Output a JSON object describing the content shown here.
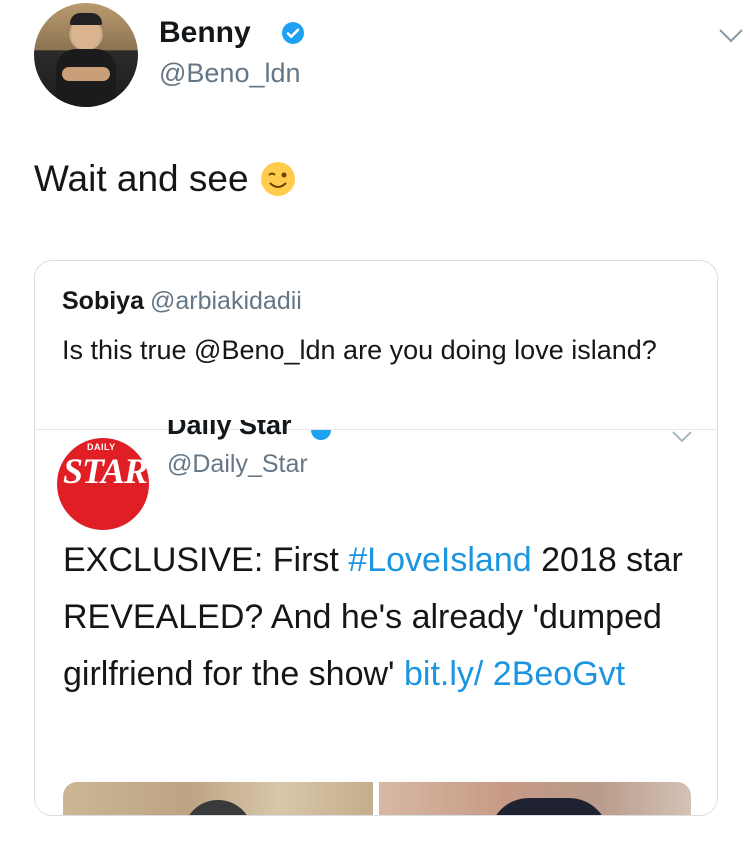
{
  "tweet": {
    "author_name": "Benny",
    "author_handle": "@Beno_ldn",
    "text": "Wait and see",
    "emoji": "winking-face",
    "verified": true
  },
  "quote": {
    "author_name": "Sobiya",
    "author_handle": "@arbiakidadii",
    "text": "Is this true @Beno_ldn are you doing love island?"
  },
  "embedded": {
    "logo_small_text": "DAILY",
    "logo_text": "STAR",
    "author_name": "Daily Star",
    "author_handle": "@Daily_Star",
    "text_part1": "EXCLUSIVE: First ",
    "hashtag": "#LoveIsland",
    "text_part2": " 2018 star REVEALED? And he's already 'dumped girlfriend for the show' ",
    "link": "bit.ly/ 2BeoGvt"
  },
  "colors": {
    "link": "#1b95e0",
    "verified": "#1da1f2",
    "muted": "#657786",
    "brand_red": "#e01e25"
  }
}
